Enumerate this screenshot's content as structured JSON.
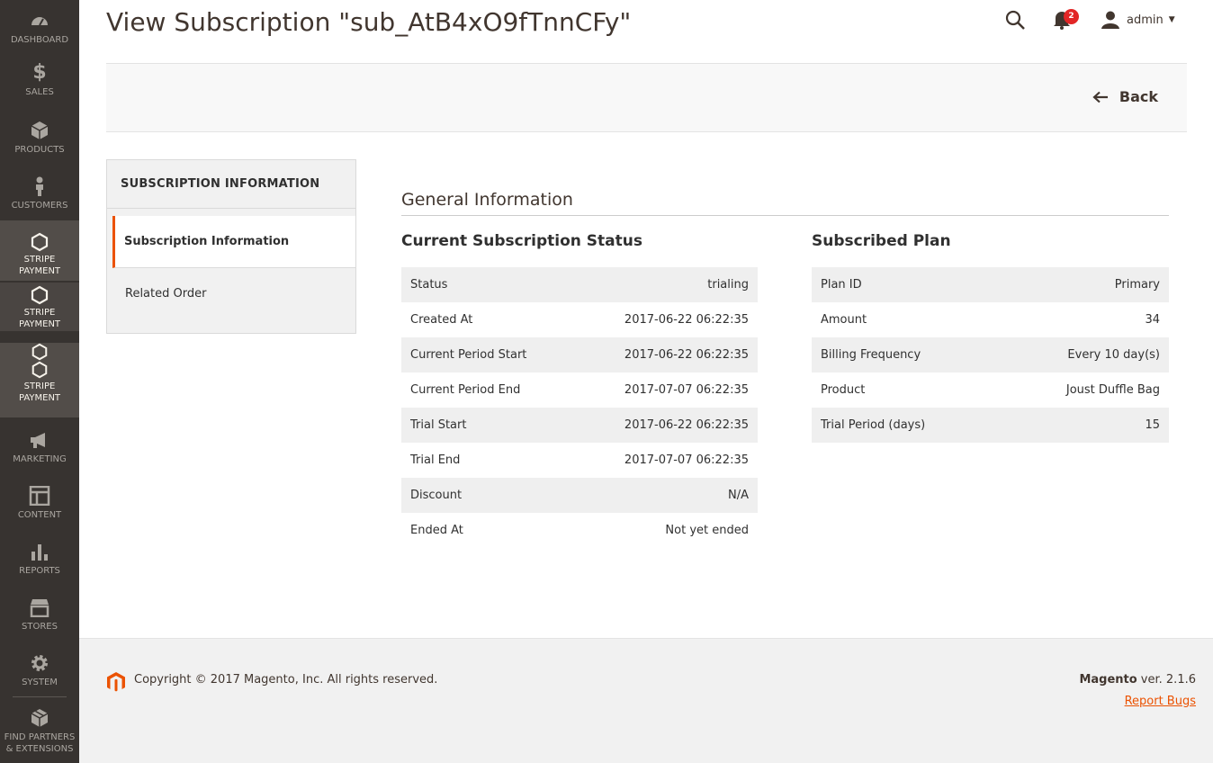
{
  "sidebar": {
    "items": [
      {
        "label": "DASHBOARD",
        "icon": "dashboard-icon"
      },
      {
        "label": "$",
        "icon": "dollar-icon"
      },
      {
        "label": "SALES"
      },
      {
        "label": "PRODUCTS",
        "icon": "cube-icon"
      },
      {
        "label": "CUSTOMERS",
        "icon": "person-icon"
      },
      {
        "label": "STRIPE",
        "label2": "PAYMENT",
        "icon": "hexagon-icon"
      },
      {
        "label": "STRIPE",
        "label2": "PAYMENT",
        "icon": "hexagon-icon"
      },
      {
        "label": "STRIPE",
        "label2": "PAYMENT",
        "icon": "hexagon-icon"
      },
      {
        "label": "MARKETING",
        "icon": "megaphone-icon"
      },
      {
        "label": "CONTENT",
        "icon": "layout-icon"
      },
      {
        "label": "REPORTS",
        "icon": "bar-chart-icon"
      },
      {
        "label": "STORES",
        "icon": "store-icon"
      },
      {
        "label": "SYSTEM",
        "icon": "gear-icon"
      },
      {
        "label": "FIND PARTNERS",
        "label2": "& EXTENSIONS",
        "icon": "box-icon"
      }
    ]
  },
  "header": {
    "title": "View Subscription \"sub_AtB4xO9fTnnCFy\"",
    "notification_count": "2",
    "user": "admin"
  },
  "actions": {
    "back_label": "Back"
  },
  "tabs": {
    "title": "SUBSCRIPTION INFORMATION",
    "items": [
      "Subscription Information",
      "Related Order"
    ]
  },
  "general": {
    "title": "General Information",
    "status_section": {
      "title": "Current Subscription Status",
      "rows": [
        {
          "label": "Status",
          "value": "trialing"
        },
        {
          "label": "Created At",
          "value": "2017-06-22 06:22:35"
        },
        {
          "label": "Current Period Start",
          "value": "2017-06-22 06:22:35"
        },
        {
          "label": "Current Period End",
          "value": "2017-07-07 06:22:35"
        },
        {
          "label": "Trial Start",
          "value": "2017-06-22 06:22:35"
        },
        {
          "label": "Trial End",
          "value": "2017-07-07 06:22:35"
        },
        {
          "label": "Discount",
          "value": "N/A"
        },
        {
          "label": "Ended At",
          "value": "Not yet ended"
        }
      ]
    },
    "plan_section": {
      "title": "Subscribed Plan",
      "rows": [
        {
          "label": "Plan ID",
          "value": "Primary"
        },
        {
          "label": "Amount",
          "value": "34"
        },
        {
          "label": "Billing Frequency",
          "value": "Every 10 day(s)"
        },
        {
          "label": "Product",
          "value": "Joust Duffle Bag"
        },
        {
          "label": "Trial Period (days)",
          "value": "15"
        }
      ]
    }
  },
  "footer": {
    "copyright": "Copyright © 2017 Magento, Inc. All rights reserved.",
    "brand": "Magento",
    "version": " ver. 2.1.6",
    "report_bugs": "Report Bugs"
  },
  "colors": {
    "sidebar_bg": "#373330",
    "accent": "#eb5202",
    "badge": "#e22626"
  }
}
